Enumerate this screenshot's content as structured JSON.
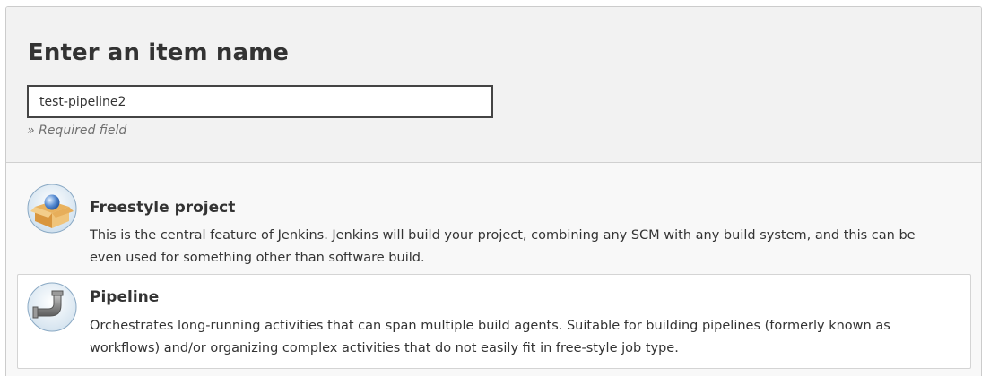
{
  "header": {
    "title": "Enter an item name",
    "name_value": "test-pipeline2",
    "required_note": "» Required field"
  },
  "items": [
    {
      "title": "Freestyle project",
      "description": "This is the central feature of Jenkins. Jenkins will build your project, combining any SCM with any build system, and this can be even used for something other than software build.",
      "icon": "freestyle-project-icon",
      "selected": false
    },
    {
      "title": "Pipeline",
      "description": "Orchestrates long-running activities that can span multiple build agents. Suitable for building pipelines (formerly known as workflows) and/or organizing complex activities that do not easily fit in free-style job type.",
      "icon": "pipeline-icon",
      "selected": true
    }
  ],
  "colors": {
    "header_bg": "#f2f2f2",
    "list_bg": "#f8f8f8",
    "selected_bg": "#ffffff",
    "text": "#333333",
    "muted": "#707070",
    "input_border": "#444444"
  }
}
